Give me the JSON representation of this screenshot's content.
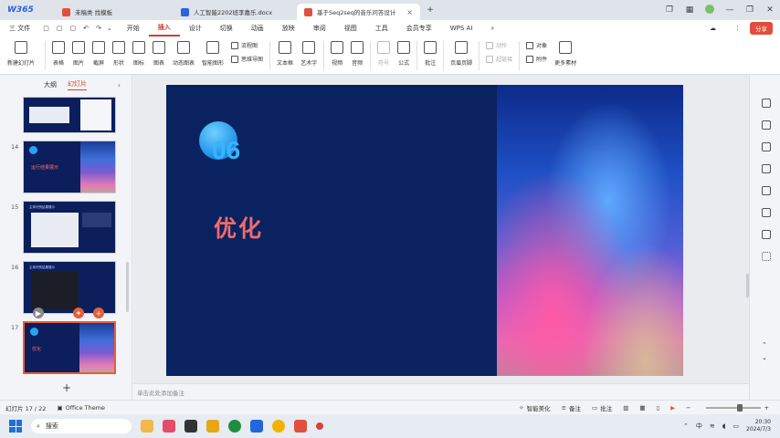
{
  "titlebar": {
    "logo": "W365",
    "tabs": [
      {
        "label": "未稿类 找模板",
        "icon_color": "#e0503c"
      },
      {
        "label": "人工智能2202班李嘉乐.docx",
        "icon_color": "#2b62e0"
      },
      {
        "label": "基于Seq2seq的音乐问答设计",
        "icon_color": "#e0503c",
        "active": true
      }
    ],
    "new_tab": "+"
  },
  "menubar": {
    "file": "三 文件",
    "items": [
      "开始",
      "插入",
      "设计",
      "切换",
      "动画",
      "放映",
      "审阅",
      "视图",
      "工具",
      "会员专享"
    ],
    "active": "插入",
    "wps_ai": "WPS AI",
    "share": "分享"
  },
  "ribbon": {
    "buttons": [
      {
        "label": "新建幻灯片"
      },
      {
        "label": "表格"
      },
      {
        "label": "图片"
      },
      {
        "label": "截屏"
      },
      {
        "label": "形状"
      },
      {
        "label": "图标"
      },
      {
        "label": "图表"
      },
      {
        "label": "动态图表"
      },
      {
        "label": "智能图形"
      }
    ],
    "stack1": [
      "流程图",
      "思维导图"
    ],
    "buttons2": [
      {
        "label": "文本框"
      },
      {
        "label": "艺术字"
      },
      {
        "label": "视频"
      },
      {
        "label": "音频"
      },
      {
        "label": "符号",
        "disabled": true
      },
      {
        "label": "公式"
      },
      {
        "label": "批注"
      },
      {
        "label": "页眉页脚"
      }
    ],
    "stack2": [
      "动作",
      "超链接"
    ],
    "stack3": [
      "对象",
      "附件"
    ],
    "more": "更多素材"
  },
  "left_panel": {
    "tabs": [
      "大纲",
      "幻灯片"
    ],
    "active_tab": "幻灯片",
    "slides": [
      {
        "num": "",
        "kind": "table"
      },
      {
        "num": "14",
        "kind": "title",
        "title": "运行结果展示"
      },
      {
        "num": "15",
        "kind": "code",
        "head": "主体识别结果展示"
      },
      {
        "num": "16",
        "kind": "code",
        "head": "主体识别结果展示"
      },
      {
        "num": "17",
        "kind": "title",
        "title": "优化",
        "selected": true
      }
    ],
    "add": "+"
  },
  "slide": {
    "number": "06",
    "title": "优化"
  },
  "notes": {
    "placeholder": "单击此处添加备注"
  },
  "statusbar": {
    "slide_count": "幻灯片 17 / 22",
    "theme": "Office Theme",
    "beautify": "智能美化",
    "notes": "备注",
    "comments": "批注",
    "zoom_fraction": 0.58
  },
  "taskbar": {
    "search": "搜索",
    "apps": [
      "#f2b84b",
      "#e54b6b",
      "#333333",
      "#e6a817",
      "#1e8e3e",
      "#2266dd",
      "#f0b400",
      "#e0503c",
      "#d9413a"
    ],
    "ime": "中",
    "time": "20:30",
    "date": "2024/7/3"
  }
}
